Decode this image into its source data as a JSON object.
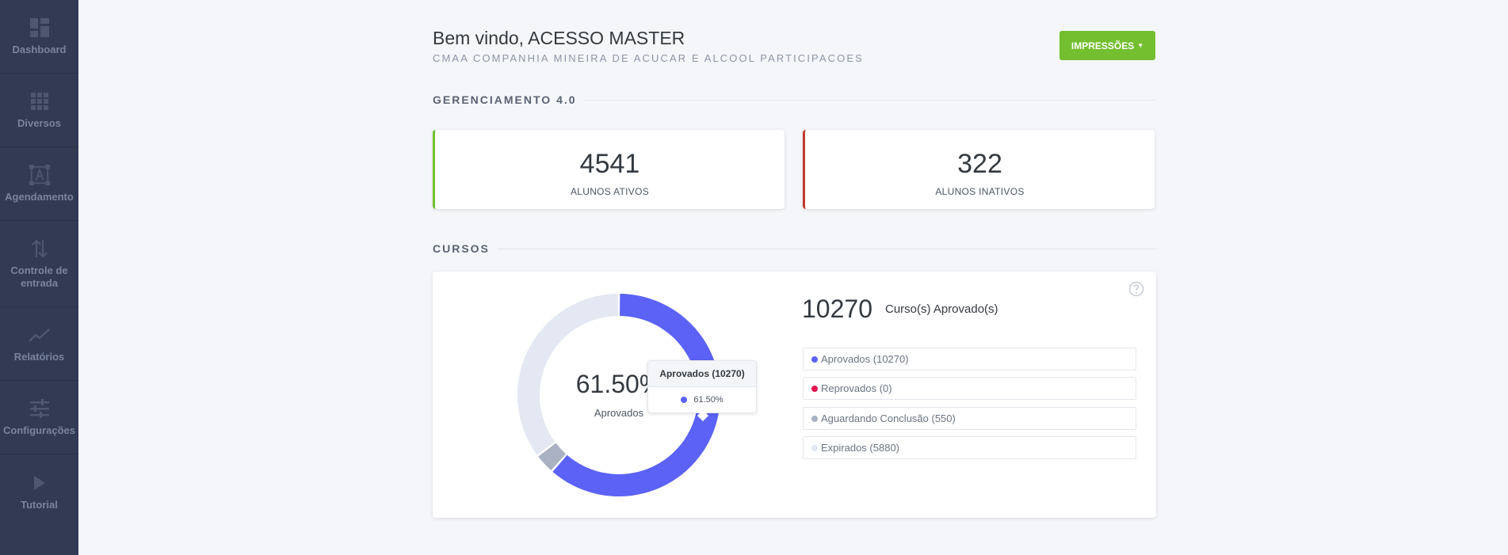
{
  "sidebar": {
    "items": [
      {
        "label": "Dashboard",
        "icon": "dashboard-icon"
      },
      {
        "label": "Diversos",
        "icon": "grid-icon"
      },
      {
        "label": "Agendamento",
        "icon": "font-frame-icon"
      },
      {
        "label": "Controle de\nentrada",
        "icon": "swap-vertical-icon"
      },
      {
        "label": "Relatórios",
        "icon": "trending-up-icon"
      },
      {
        "label": "Configurações",
        "icon": "sliders-icon"
      },
      {
        "label": "Tutorial",
        "icon": "play-icon"
      }
    ]
  },
  "header": {
    "welcome": "Bem vindo, ACESSO MASTER",
    "company": "CMAA COMPANHIA MINEIRA DE ACUCAR E ALCOOL PARTICIPACOES",
    "print_button": "IMPRESSÕES"
  },
  "management": {
    "title": "GERENCIAMENTO 4.0",
    "active": {
      "value": "4541",
      "label": "ALUNOS ATIVOS"
    },
    "inactive": {
      "value": "322",
      "label": "ALUNOS INATIVOS"
    }
  },
  "courses": {
    "title": "CURSOS",
    "total_value": "10270",
    "total_label": "Curso(s) Aprovado(s)",
    "center_percent": "61.50%",
    "center_label": "Aprovados",
    "tooltip": {
      "title": "Aprovados (10270)",
      "value": "61.50%"
    },
    "legend": [
      {
        "label": "Aprovados (10270)",
        "color": "#5b62f5"
      },
      {
        "label": "Reprovados (0)",
        "color": "#e0174f"
      },
      {
        "label": "Aguardando Conclusão (550)",
        "color": "#a9b1c2"
      },
      {
        "label": "Expirados (5880)",
        "color": "#e3e8f2"
      }
    ]
  },
  "chart_data": {
    "type": "pie",
    "categories": [
      "Aprovados",
      "Reprovados",
      "Aguardando Conclusão",
      "Expirados"
    ],
    "values": [
      10270,
      0,
      550,
      5880
    ],
    "colors": [
      "#5b62f5",
      "#e0174f",
      "#a9b1c2",
      "#e3e8f2"
    ]
  }
}
